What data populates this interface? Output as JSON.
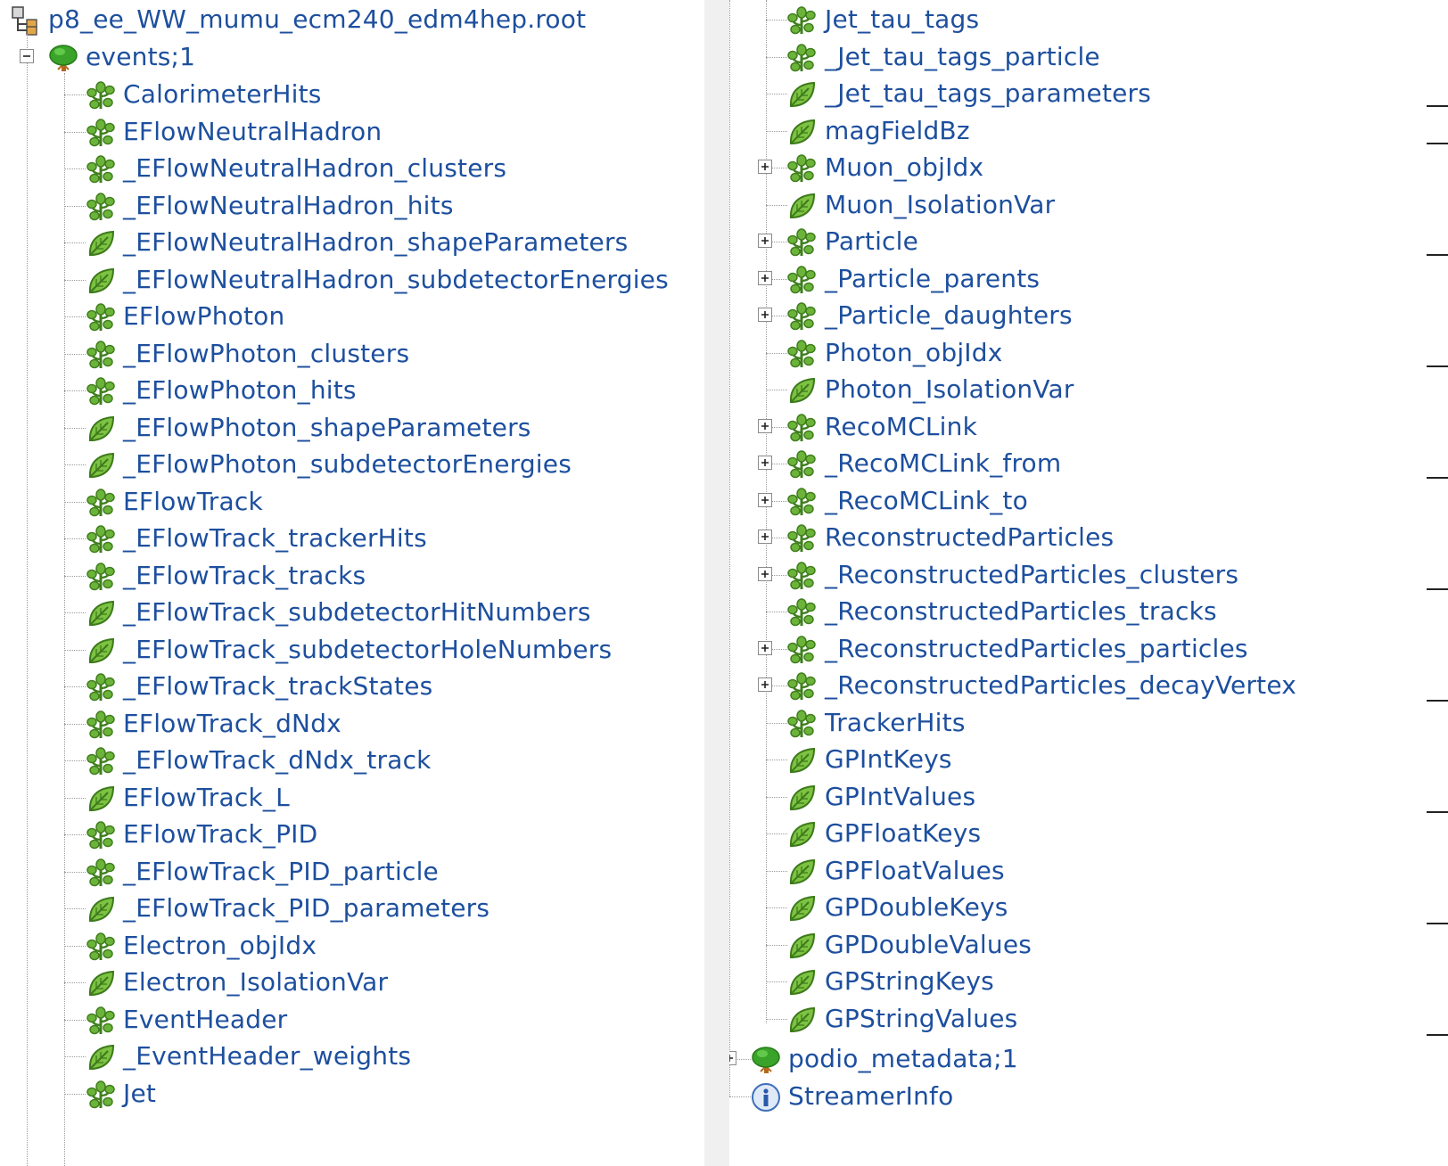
{
  "file": {
    "name": "p8_ee_WW_mumu_ecm240_edm4hep.root",
    "icon": "root-file-icon"
  },
  "events_tree": {
    "name": "events;1",
    "icon": "tree-icon",
    "expanded": true
  },
  "left_branches": [
    {
      "label": "CalorimeterHits",
      "icon": "branch-icon"
    },
    {
      "label": "EFlowNeutralHadron",
      "icon": "branch-icon"
    },
    {
      "label": "_EFlowNeutralHadron_clusters",
      "icon": "branch-icon"
    },
    {
      "label": "_EFlowNeutralHadron_hits",
      "icon": "branch-icon"
    },
    {
      "label": "_EFlowNeutralHadron_shapeParameters",
      "icon": "leaf-icon"
    },
    {
      "label": "_EFlowNeutralHadron_subdetectorEnergies",
      "icon": "leaf-icon"
    },
    {
      "label": "EFlowPhoton",
      "icon": "branch-icon"
    },
    {
      "label": "_EFlowPhoton_clusters",
      "icon": "branch-icon"
    },
    {
      "label": "_EFlowPhoton_hits",
      "icon": "branch-icon"
    },
    {
      "label": "_EFlowPhoton_shapeParameters",
      "icon": "leaf-icon"
    },
    {
      "label": "_EFlowPhoton_subdetectorEnergies",
      "icon": "leaf-icon"
    },
    {
      "label": "EFlowTrack",
      "icon": "branch-icon"
    },
    {
      "label": "_EFlowTrack_trackerHits",
      "icon": "branch-icon"
    },
    {
      "label": "_EFlowTrack_tracks",
      "icon": "branch-icon"
    },
    {
      "label": "_EFlowTrack_subdetectorHitNumbers",
      "icon": "leaf-icon"
    },
    {
      "label": "_EFlowTrack_subdetectorHoleNumbers",
      "icon": "leaf-icon"
    },
    {
      "label": "_EFlowTrack_trackStates",
      "icon": "branch-icon"
    },
    {
      "label": "EFlowTrack_dNdx",
      "icon": "branch-icon"
    },
    {
      "label": "_EFlowTrack_dNdx_track",
      "icon": "branch-icon"
    },
    {
      "label": "EFlowTrack_L",
      "icon": "leaf-icon"
    },
    {
      "label": "EFlowTrack_PID",
      "icon": "branch-icon"
    },
    {
      "label": "_EFlowTrack_PID_particle",
      "icon": "branch-icon"
    },
    {
      "label": "_EFlowTrack_PID_parameters",
      "icon": "leaf-icon"
    },
    {
      "label": "Electron_objIdx",
      "icon": "branch-icon"
    },
    {
      "label": "Electron_IsolationVar",
      "icon": "leaf-icon"
    },
    {
      "label": "EventHeader",
      "icon": "branch-icon"
    },
    {
      "label": "_EventHeader_weights",
      "icon": "leaf-icon"
    },
    {
      "label": "Jet",
      "icon": "branch-icon"
    }
  ],
  "right_branches": [
    {
      "label": "Jet_tau_tags",
      "icon": "branch-icon",
      "expander": false
    },
    {
      "label": "_Jet_tau_tags_particle",
      "icon": "branch-icon",
      "expander": false
    },
    {
      "label": "_Jet_tau_tags_parameters",
      "icon": "leaf-icon",
      "expander": false
    },
    {
      "label": "magFieldBz",
      "icon": "leaf-icon",
      "expander": false
    },
    {
      "label": "Muon_objIdx",
      "icon": "branch-icon",
      "expander": true
    },
    {
      "label": "Muon_IsolationVar",
      "icon": "leaf-icon",
      "expander": false
    },
    {
      "label": "Particle",
      "icon": "branch-icon",
      "expander": true
    },
    {
      "label": "_Particle_parents",
      "icon": "branch-icon",
      "expander": true
    },
    {
      "label": "_Particle_daughters",
      "icon": "branch-icon",
      "expander": true
    },
    {
      "label": "Photon_objIdx",
      "icon": "branch-icon",
      "expander": false
    },
    {
      "label": "Photon_IsolationVar",
      "icon": "leaf-icon",
      "expander": false
    },
    {
      "label": "RecoMCLink",
      "icon": "branch-icon",
      "expander": true
    },
    {
      "label": "_RecoMCLink_from",
      "icon": "branch-icon",
      "expander": true
    },
    {
      "label": "_RecoMCLink_to",
      "icon": "branch-icon",
      "expander": true
    },
    {
      "label": "ReconstructedParticles",
      "icon": "branch-icon",
      "expander": true
    },
    {
      "label": "_ReconstructedParticles_clusters",
      "icon": "branch-icon",
      "expander": true
    },
    {
      "label": "_ReconstructedParticles_tracks",
      "icon": "branch-icon",
      "expander": false
    },
    {
      "label": "_ReconstructedParticles_particles",
      "icon": "branch-icon",
      "expander": true
    },
    {
      "label": "_ReconstructedParticles_decayVertex",
      "icon": "branch-icon",
      "expander": true
    },
    {
      "label": "TrackerHits",
      "icon": "branch-icon",
      "expander": false
    },
    {
      "label": "GPIntKeys",
      "icon": "leaf-icon",
      "expander": false
    },
    {
      "label": "GPIntValues",
      "icon": "leaf-icon",
      "expander": false
    },
    {
      "label": "GPFloatKeys",
      "icon": "leaf-icon",
      "expander": false
    },
    {
      "label": "GPFloatValues",
      "icon": "leaf-icon",
      "expander": false
    },
    {
      "label": "GPDoubleKeys",
      "icon": "leaf-icon",
      "expander": false
    },
    {
      "label": "GPDoubleValues",
      "icon": "leaf-icon",
      "expander": false
    },
    {
      "label": "GPStringKeys",
      "icon": "leaf-icon",
      "expander": false
    },
    {
      "label": "GPStringValues",
      "icon": "leaf-icon",
      "expander": false
    }
  ],
  "root_items": [
    {
      "label": "podio_metadata;1",
      "icon": "tree-icon",
      "expander": true
    },
    {
      "label": "StreamerInfo",
      "icon": "info-icon",
      "expander": false
    }
  ],
  "colors": {
    "link": "#1d4f9e",
    "connector": "#9a9a9a"
  }
}
